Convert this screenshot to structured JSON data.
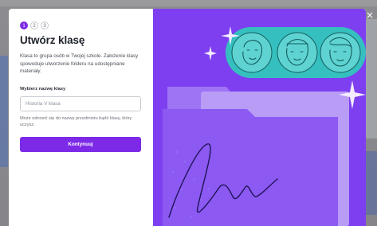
{
  "steps": [
    "1",
    "2",
    "3"
  ],
  "active_step": 1,
  "title": "Utwórz klasę",
  "description": "Klasa to grupa osób w Twojej szkole. Założenie klasy spowoduje utworzenie folderu na udostępniane materiały.",
  "class_name": {
    "label": "Wybierz nazwę klasy",
    "placeholder": "Historia V klasa",
    "value": "",
    "hint": "Może odnosić się do nazwy przedmiotu bądź klasy, który uczysz."
  },
  "continue_label": "Kontynuuj",
  "close_glyph": "×",
  "colors": {
    "accent": "#7d2ae8",
    "illustration_bg": "#7e3ff0",
    "avatar_pill": "#35c0bf"
  },
  "icons": [
    "close-icon",
    "sparkle-icon",
    "avatar-icon",
    "folder-illustration",
    "signature-scribble"
  ]
}
